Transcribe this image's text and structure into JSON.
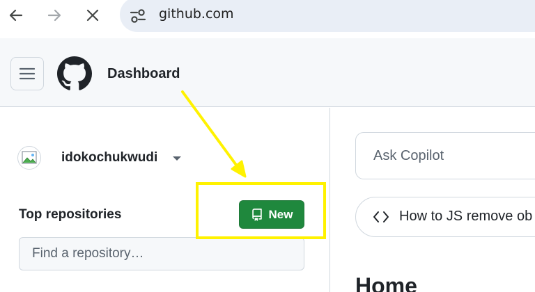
{
  "browser": {
    "url": "github.com",
    "icons": {
      "back": "arrow-left-icon",
      "forward": "arrow-right-icon",
      "stop": "close-icon",
      "site_info": "tune-icon"
    }
  },
  "header": {
    "title": "Dashboard",
    "icons": {
      "menu": "hamburger-icon",
      "logo": "github-logo"
    }
  },
  "sidebar": {
    "username": "idokochukwudi",
    "top_repositories_label": "Top repositories",
    "new_button_label": "New",
    "new_button_icon": "repo-icon",
    "find_placeholder": "Find a repository…"
  },
  "main": {
    "ask_placeholder": "Ask Copilot",
    "suggestion_text": "How to JS remove ob",
    "suggestion_icon": "code-icon",
    "home_title": "Home"
  },
  "annotation": {
    "color": "#fff200",
    "type": "arrow-and-box"
  },
  "colors": {
    "primary_button": "#1f883d",
    "header_bg": "#f6f8fa",
    "border": "#d0d7de",
    "omnibox_bg": "#e9eef6"
  }
}
